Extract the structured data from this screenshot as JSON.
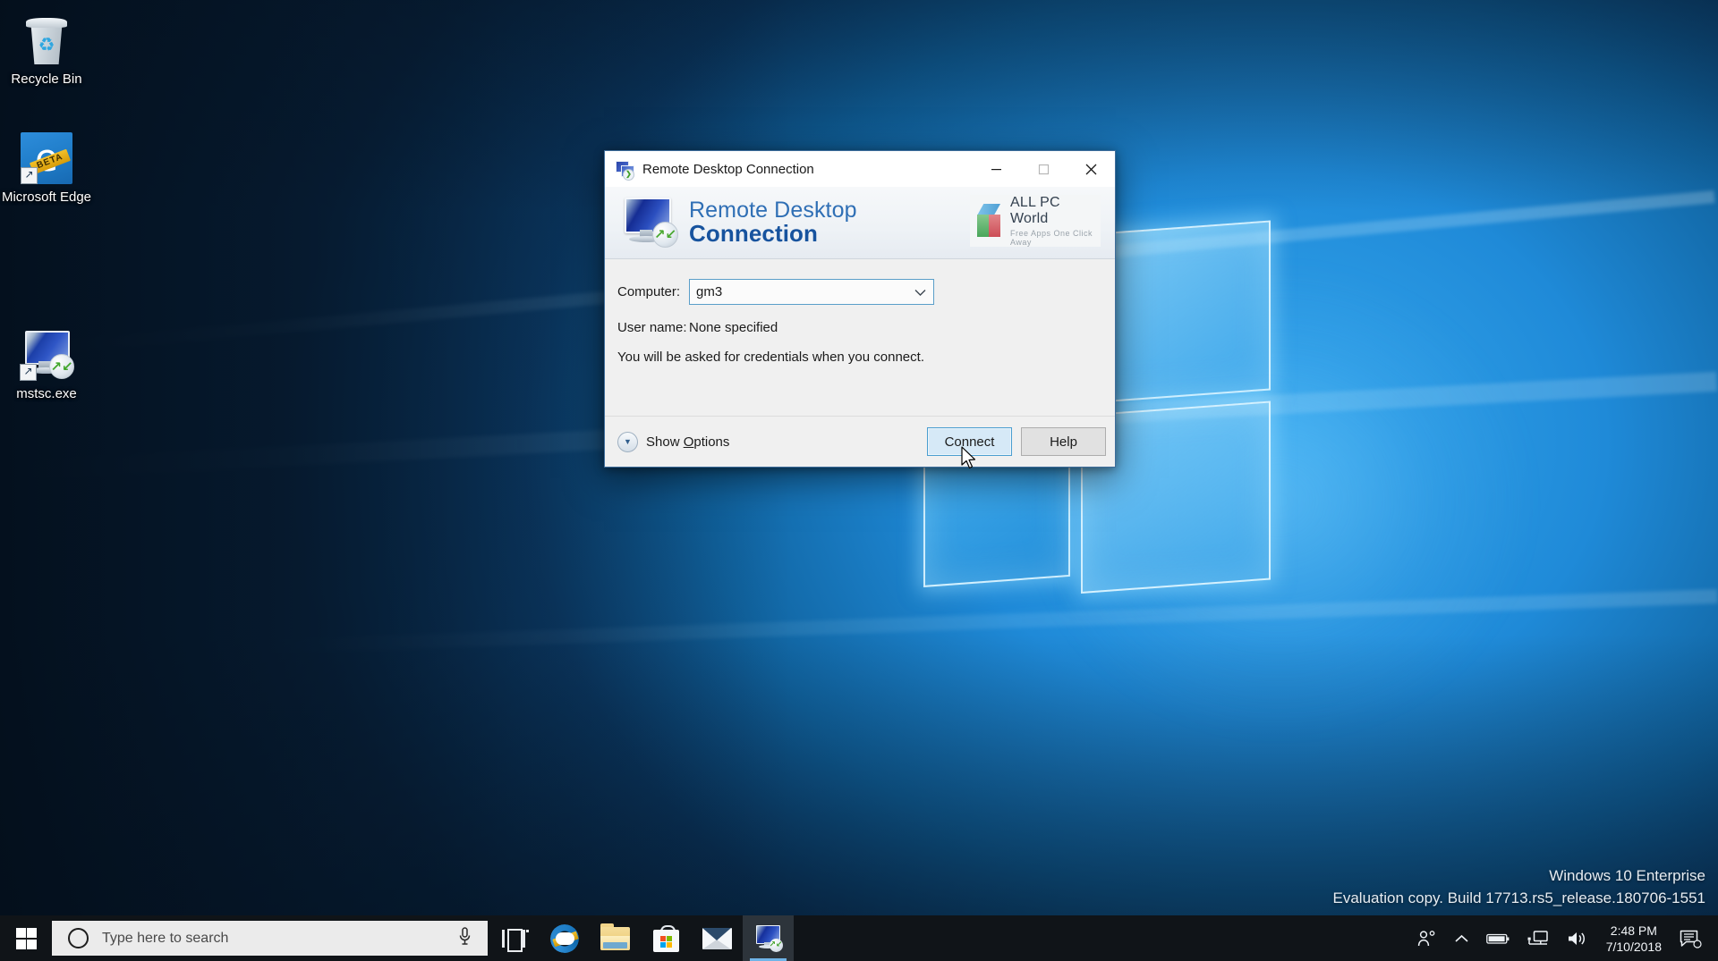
{
  "desktop": {
    "icons": [
      {
        "name": "recycle-bin",
        "label": "Recycle Bin"
      },
      {
        "name": "microsoft-edge",
        "label": "Microsoft Edge",
        "badge": "BETA"
      },
      {
        "name": "mstsc-exe",
        "label": "mstsc.exe"
      }
    ],
    "watermark": {
      "line1": "Windows 10 Enterprise",
      "line2": "Evaluation copy. Build 17713.rs5_release.180706-1551"
    }
  },
  "rdc_window": {
    "title": "Remote Desktop Connection",
    "title_buttons": {
      "minimize": "—",
      "maximize": "□",
      "close": "✕"
    },
    "banner": {
      "line1": "Remote Desktop",
      "line2": "Connection",
      "badge": {
        "title": "ALL PC World",
        "tagline": "Free Apps One Click Away"
      }
    },
    "form": {
      "computer_label": "Computer:",
      "computer_value": "gm3",
      "username_label": "User name:",
      "username_value": "None specified",
      "credentials_hint": "You will be asked for credentials when you connect."
    },
    "footer": {
      "show_options_label": "Show Options",
      "show_options_accesskey": "O",
      "connect_label": "Connect",
      "help_label": "Help"
    },
    "colors": {
      "accent": "#17539e",
      "banner_title": "#2f6fb5",
      "focus_border": "#4b9ed0"
    }
  },
  "taskbar": {
    "start_label": "Start",
    "search": {
      "placeholder": "Type here to search"
    },
    "apps": [
      {
        "name": "task-view",
        "label": "Task View"
      },
      {
        "name": "microsoft-edge",
        "label": "Microsoft Edge"
      },
      {
        "name": "file-explorer",
        "label": "File Explorer"
      },
      {
        "name": "microsoft-store",
        "label": "Microsoft Store"
      },
      {
        "name": "mail",
        "label": "Mail"
      },
      {
        "name": "remote-desktop-connection",
        "label": "Remote Desktop Connection",
        "active": true
      }
    ],
    "tray": {
      "people": "People",
      "show_hidden": "Show hidden icons",
      "battery": "Battery",
      "network": "Network",
      "volume": "Volume",
      "time": "2:48 PM",
      "date": "7/10/2018",
      "action_center": "Action Center"
    }
  }
}
